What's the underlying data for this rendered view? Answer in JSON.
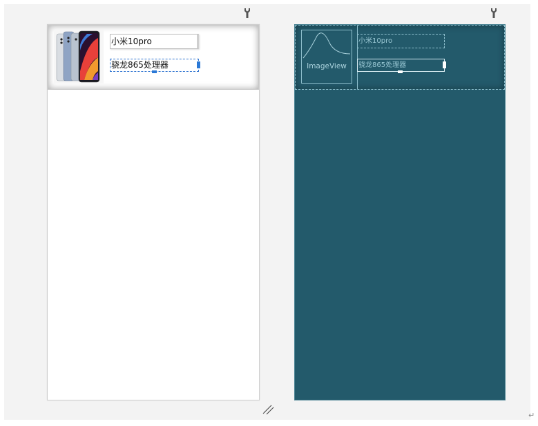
{
  "design_view": {
    "title_text": "小米10pro",
    "desc_text": "骁龙865处理器",
    "image_icon": "phone-product-image"
  },
  "blueprint_view": {
    "image_label": "ImageView",
    "title_text": "小米10pro",
    "desc_text": "骁龙865处理器"
  },
  "toolbar": {
    "wrench_icon": "wrench-icon",
    "resize_icon": "resize-grip-icon"
  },
  "colors": {
    "stage_bg": "#f3f3f3",
    "blueprint_bg": "#235a6b",
    "selection": "#2a78d6"
  },
  "trailing_mark": "↵"
}
